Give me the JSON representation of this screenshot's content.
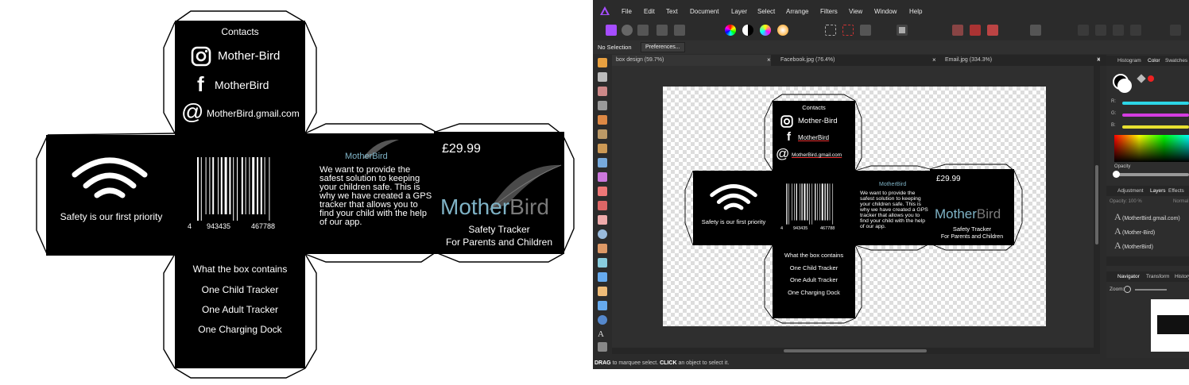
{
  "net": {
    "contacts_title": "Contacts",
    "instagram": "Mother-Bird",
    "facebook": "MotherBird",
    "email": "MotherBird.gmail.com",
    "safety": "Safety is our first priority",
    "barcode_left": "4",
    "barcode_mid": "943435",
    "barcode_right": "467788",
    "brand_small": "MotherBird",
    "description": "We want to provide the safest solution to keeping your children safe. This is why we have created a GPS tracker that allows you to find your child with the help of our app.",
    "price": "£29.99",
    "brand_mother": "Mother",
    "brand_bird": "Bird",
    "tagline1": "Safety Tracker",
    "tagline2": "For Parents and Children",
    "box_title": "What the box contains",
    "item1": "One Child Tracker",
    "item2": "One Adult Tracker",
    "item3": "One Charging Dock"
  },
  "colors": {
    "brand_teal": "#7fb3c6",
    "brand_grey": "#7a7a7a",
    "app_bg": "#2b2b2b",
    "accent_purple": "#a64dff"
  },
  "app": {
    "menu": [
      "File",
      "Edit",
      "Text",
      "Document",
      "Layer",
      "Select",
      "Arrange",
      "Filters",
      "View",
      "Window",
      "Help"
    ],
    "context": {
      "no_selection": "No Selection",
      "preferences": "Preferences..."
    },
    "tabs": [
      {
        "label": "box design (59.7%)",
        "close": "×"
      },
      {
        "label": "Facebook.jpg (76.4%)",
        "close": "×"
      },
      {
        "label": "Email.jpg (334.3%)",
        "close": "×"
      }
    ],
    "panel_close": "×",
    "status": {
      "drag": "DRAG",
      "drag_text": " to marquee select. ",
      "click": "CLICK",
      "click_text": " an object to select it."
    },
    "color_panel": {
      "tabs": [
        "Histogram",
        "Color",
        "Swatches"
      ],
      "channels": [
        "R:",
        "G:",
        "B:"
      ],
      "opacity_label": "Opacity"
    },
    "layers_panel": {
      "tabs": [
        "Adjustment",
        "Layers",
        "Effects"
      ],
      "opacity": "Opacity: 100 %",
      "blend": "Normal",
      "layers": [
        "(MotherBird.gmail.com)",
        "(Mother-Bird)",
        "(MotherBird)"
      ]
    },
    "navigator": {
      "tabs": [
        "Navigator",
        "Transform",
        "History"
      ],
      "zoom_label": "Zoom:"
    }
  }
}
